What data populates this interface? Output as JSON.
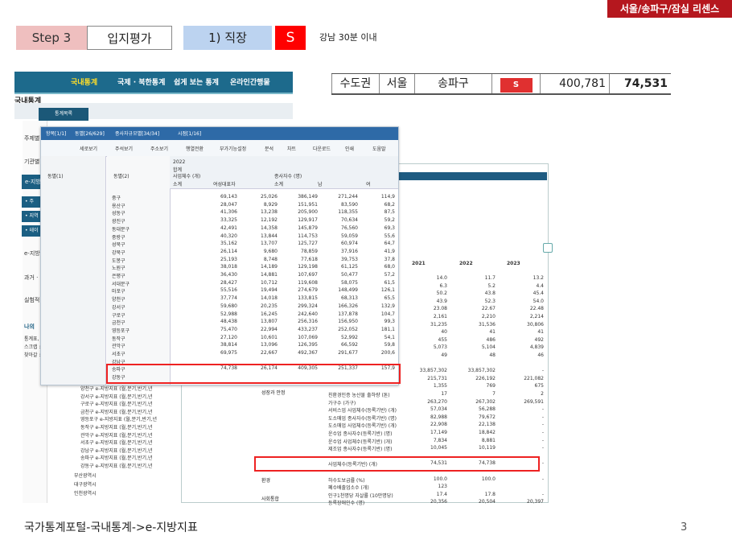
{
  "header": {
    "license_badge": "서울/송파구/잠실 리센스",
    "step": "Step 3",
    "location_eval": "입지평가",
    "job_label": "1) 직장",
    "grade": "S",
    "description": "강남 30분 이내"
  },
  "summary": {
    "region": "수도권",
    "city": "서울",
    "district": "송파구",
    "grade": "S",
    "value1": "400,781",
    "value2": "74,531"
  },
  "kosis": {
    "nav": [
      "국내통계",
      "국제 · 북한통계",
      "쉽게 보는 통계",
      "온라인간행물"
    ],
    "page_title": "국내통계",
    "category_tab": "통계목록",
    "left_menu": [
      "주제별",
      "기관별",
      "e-지방",
      "• 주",
      "• 지역",
      "• 테이",
      "e-지방",
      "과거 ·",
      "실험적",
      "나의",
      "통계표,",
      "스크랩 :",
      "찾아갈 :"
    ]
  },
  "dialog": {
    "tabs": [
      "항목[1/1]",
      "동별[26/629]",
      "종사자규모별[34/34]",
      "시점[1/16]"
    ],
    "toolbar": [
      "세로보기",
      "주석보기",
      "주소보기",
      "행열전환",
      "부가기능설정",
      "분석",
      "차트",
      "다운로드",
      "인쇄",
      "도움말"
    ],
    "col_group1": "동별(1)",
    "col_group2": "동별(2)",
    "year": "2022",
    "header_total": "합계",
    "header_biz": "사업체수 (개)",
    "header_emp": "종사자수 (명)",
    "sub_headers": [
      "소계",
      "여성대표자",
      "소계",
      "남",
      "여"
    ],
    "rows": [
      {
        "name": "중구",
        "v": [
          "69,143",
          "25,026",
          "386,149",
          "271,244",
          "114,9"
        ]
      },
      {
        "name": "용산구",
        "v": [
          "28,047",
          "8,929",
          "151,951",
          "83,590",
          "68,2"
        ]
      },
      {
        "name": "성동구",
        "v": [
          "41,306",
          "13,238",
          "205,900",
          "118,355",
          "87,5"
        ]
      },
      {
        "name": "광진구",
        "v": [
          "33,325",
          "12,192",
          "129,917",
          "70,634",
          "59,2"
        ]
      },
      {
        "name": "동대문구",
        "v": [
          "42,491",
          "14,358",
          "145,879",
          "76,560",
          "69,3"
        ]
      },
      {
        "name": "중랑구",
        "v": [
          "40,320",
          "13,844",
          "114,753",
          "59,059",
          "55,6"
        ]
      },
      {
        "name": "성북구",
        "v": [
          "35,162",
          "13,707",
          "125,727",
          "60,974",
          "64,7"
        ]
      },
      {
        "name": "강북구",
        "v": [
          "26,114",
          "9,680",
          "78,859",
          "37,916",
          "41,9"
        ]
      },
      {
        "name": "도봉구",
        "v": [
          "25,193",
          "8,748",
          "77,618",
          "39,753",
          "37,8"
        ]
      },
      {
        "name": "노원구",
        "v": [
          "38,018",
          "14,189",
          "129,198",
          "61,125",
          "68,0"
        ]
      },
      {
        "name": "은평구",
        "v": [
          "36,430",
          "14,881",
          "107,697",
          "50,477",
          "57,2"
        ]
      },
      {
        "name": "서대문구",
        "v": [
          "28,427",
          "10,712",
          "119,608",
          "58,075",
          "61,5"
        ]
      },
      {
        "name": "마포구",
        "v": [
          "55,516",
          "19,494",
          "274,679",
          "148,499",
          "126,1"
        ]
      },
      {
        "name": "양천구",
        "v": [
          "37,774",
          "14,018",
          "133,815",
          "68,313",
          "65,5"
        ]
      },
      {
        "name": "강서구",
        "v": [
          "59,680",
          "20,235",
          "299,324",
          "166,326",
          "132,9"
        ]
      },
      {
        "name": "구로구",
        "v": [
          "52,988",
          "16,245",
          "242,640",
          "137,878",
          "104,7"
        ]
      },
      {
        "name": "금천구",
        "v": [
          "48,438",
          "13,807",
          "256,316",
          "156,950",
          "99,3"
        ]
      },
      {
        "name": "영등포구",
        "v": [
          "75,470",
          "22,994",
          "433,237",
          "252,052",
          "181,1"
        ]
      },
      {
        "name": "동작구",
        "v": [
          "27,120",
          "10,601",
          "107,069",
          "52,992",
          "54,1"
        ]
      },
      {
        "name": "관악구",
        "v": [
          "38,814",
          "13,096",
          "126,395",
          "66,592",
          "59,8"
        ]
      },
      {
        "name": "서초구",
        "v": [
          "69,975",
          "22,667",
          "492,367",
          "291,677",
          "200,6"
        ]
      },
      {
        "name": "강남구",
        "v": [
          "",
          "",
          "",
          "",
          ""
        ]
      },
      {
        "name": "송파구",
        "v": [
          "74,738",
          "26,174",
          "409,305",
          "251,337",
          "157,9"
        ]
      },
      {
        "name": "강동구",
        "v": [
          "",
          "",
          "",
          "",
          ""
        ]
      }
    ]
  },
  "back_table": {
    "years": [
      "2021",
      "2022",
      "2023"
    ],
    "rows": [
      {
        "label": "",
        "v": [
          "14.0",
          "11.7",
          "13.2"
        ]
      },
      {
        "label": "",
        "v": [
          "6.3",
          "5.2",
          "4.4"
        ]
      },
      {
        "label": "",
        "v": [
          "50.2",
          "43.8",
          "45.4"
        ]
      },
      {
        "label": "",
        "v": [
          "43.9",
          "52.3",
          "54.0"
        ]
      },
      {
        "label": "",
        "v": [
          "23.08",
          "22.67",
          "22.48"
        ]
      },
      {
        "label": "",
        "v": [
          "2,161",
          "2,210",
          "2,214"
        ]
      },
      {
        "label": "",
        "v": [
          "31,235",
          "31,536",
          "30,806"
        ]
      },
      {
        "label": "",
        "v": [
          "40",
          "41",
          "41"
        ]
      },
      {
        "label": "",
        "v": [
          "455",
          "486",
          "492"
        ]
      },
      {
        "label": "",
        "v": [
          "5,073",
          "5,104",
          "4,839"
        ]
      },
      {
        "label": "",
        "v": [
          "49",
          "48",
          "46"
        ]
      },
      {
        "label": "",
        "v": [
          "",
          "",
          ""
        ]
      },
      {
        "label": "",
        "v": [
          "33,857,302",
          "33,857,302",
          "-"
        ]
      },
      {
        "label": "",
        "v": [
          "215,731",
          "226,192",
          "221,082"
        ]
      },
      {
        "label": "",
        "v": [
          "1,355",
          "769",
          "675"
        ]
      },
      {
        "label": "친환경인증 농산물 출하량 (톤)",
        "v": [
          "17",
          "7",
          "2"
        ]
      },
      {
        "label": "가구수 (가구)",
        "v": [
          "263,270",
          "267,302",
          "269,591"
        ]
      },
      {
        "label": "서비스업 사업체수(등록기반) (개)",
        "v": [
          "57,034",
          "56,288",
          "-"
        ]
      },
      {
        "label": "도소매업 종사자수(등록기반) (명)",
        "v": [
          "82,988",
          "79,672",
          "-"
        ]
      },
      {
        "label": "도소매업 사업체수(등록기반) (개)",
        "v": [
          "22,908",
          "22,138",
          "-"
        ]
      },
      {
        "label": "운수업 종사자수(등록기반) (명)",
        "v": [
          "17,149",
          "18,842",
          "-"
        ]
      },
      {
        "label": "운수업 사업체수(등록기반) (개)",
        "v": [
          "7,834",
          "8,881",
          "-"
        ]
      },
      {
        "label": "제조업 종사자수(등록기반) (명)",
        "v": [
          "10,045",
          "10,119",
          "-"
        ]
      },
      {
        "label": "",
        "v": [
          "",
          "",
          ""
        ]
      },
      {
        "label": "사업체수(등록기반) (개)",
        "v": [
          "74,531",
          "74,738",
          "-"
        ]
      },
      {
        "label": "",
        "v": [
          "",
          "",
          ""
        ]
      },
      {
        "label": "하수도보급률 (%)",
        "v": [
          "100.0",
          "100.0",
          "-"
        ]
      },
      {
        "label": "폐수배출업소수 (개)",
        "v": [
          "123",
          "",
          ""
        ]
      },
      {
        "label": "인구1천명당 자살률 (10만명당)",
        "v": [
          "17.4",
          "17.8",
          "-"
        ]
      },
      {
        "label": "등록장애인수 (명)",
        "v": [
          "20,356",
          "20,504",
          "20,397"
        ]
      }
    ],
    "categories": [
      "성장과 안정",
      "환경",
      "사회통합"
    ],
    "tree": [
      "양천구 e-지방지표 (월,분기,반기,년",
      "강서구 e-지방지표 (월,분기,반기,년",
      "구로구 e-지방지표 (월,분기,반기,년",
      "금천구 e-지방지표 (월,분기,반기,년",
      "영등포구 e-지방지표 (월,분기,반기,년",
      "동작구 e-지방지표 (월,분기,반기,년",
      "관악구 e-지방지표 (월,분기,반기,년",
      "서초구 e-지방지표 (월,분기,반기,년",
      "강남구 e-지방지표 (월,분기,반기,년",
      "송파구 e-지방지표 (월,분기,반기,년",
      "강동구 e-지방지표 (월,분기,반기,년",
      "부산광역시",
      "대구광역시",
      "인천광역시"
    ]
  },
  "footer": {
    "caption": "국가통계포털-국내통계->e-지방지표",
    "page_number": "3"
  }
}
